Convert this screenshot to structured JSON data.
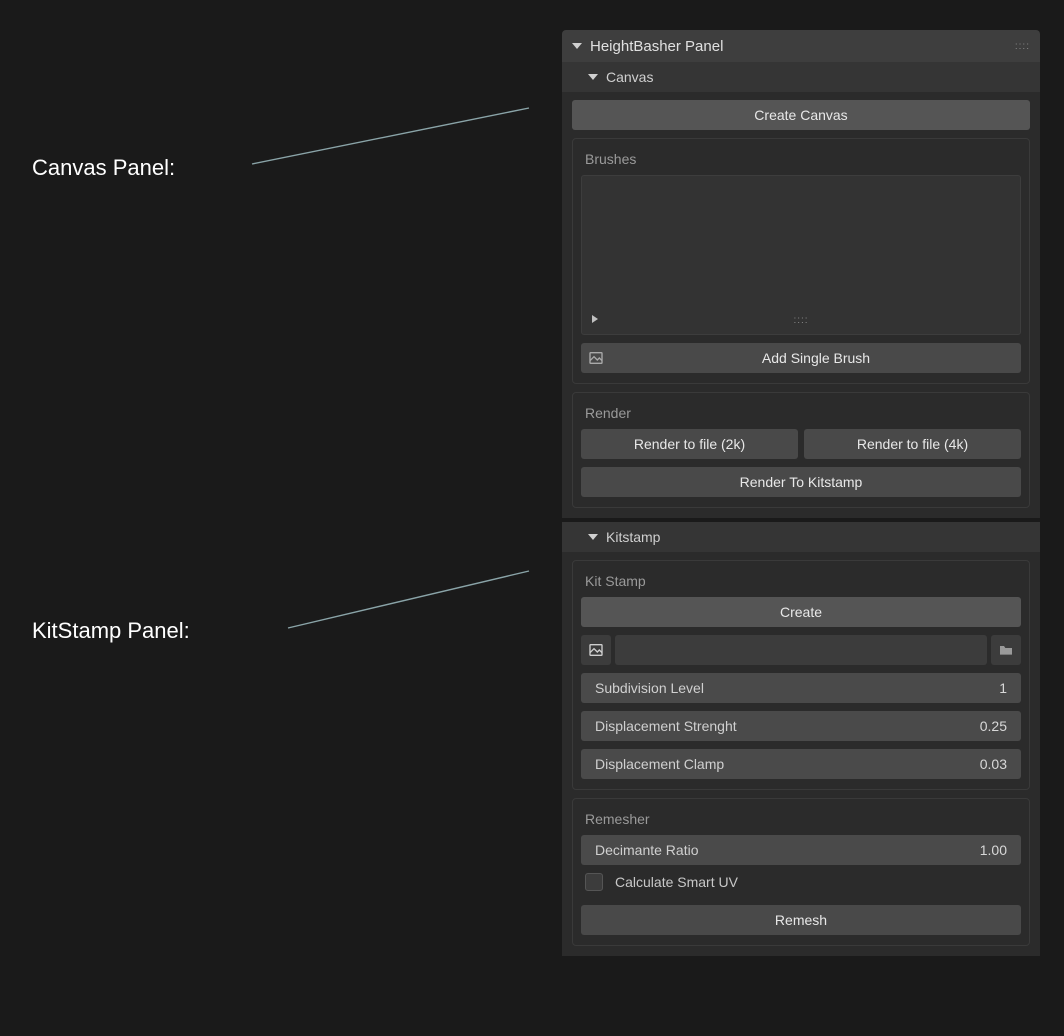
{
  "annotations": {
    "canvas_label": "Canvas Panel:",
    "kitstamp_label": "KitStamp  Panel:"
  },
  "panel": {
    "title": "HeightBasher Panel",
    "canvas": {
      "header": "Canvas",
      "create_canvas": "Create Canvas",
      "brushes_label": "Brushes",
      "add_single_brush": "Add Single Brush",
      "render_label": "Render",
      "render_2k": "Render to file (2k)",
      "render_4k": "Render to file (4k)",
      "render_kitstamp": "Render To Kitstamp"
    },
    "kitstamp": {
      "header": "Kitstamp",
      "box_label": "Kit Stamp",
      "create": "Create",
      "subdivision_label": "Subdivision Level",
      "subdivision_value": "1",
      "disp_strength_label": "Displacement Strenght",
      "disp_strength_value": "0.25",
      "disp_clamp_label": "Displacement Clamp",
      "disp_clamp_value": "0.03",
      "remesher_label": "Remesher",
      "decimate_label": "Decimante Ratio",
      "decimate_value": "1.00",
      "smart_uv_label": "Calculate Smart UV",
      "remesh": "Remesh"
    }
  }
}
